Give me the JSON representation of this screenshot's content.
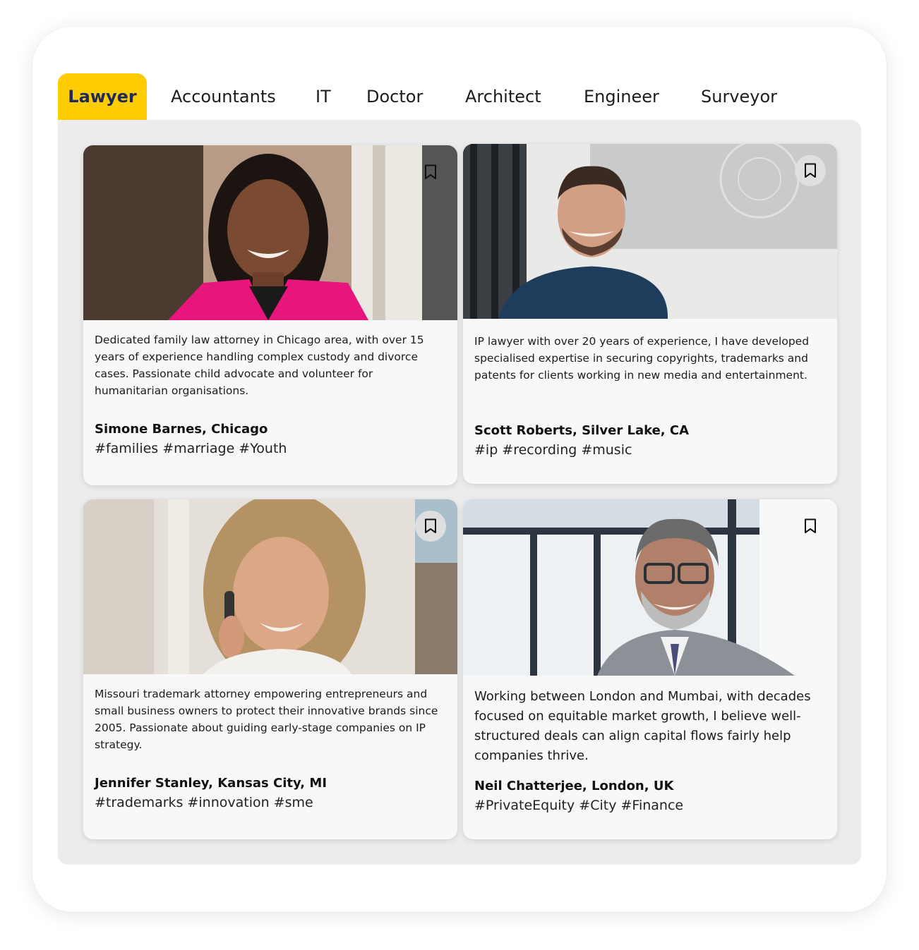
{
  "tabs": [
    {
      "label": "Lawyer",
      "active": true
    },
    {
      "label": "Accountants",
      "active": false
    },
    {
      "label": "IT",
      "active": false
    },
    {
      "label": "Doctor",
      "active": false
    },
    {
      "label": "Architect",
      "active": false
    },
    {
      "label": "Engineer",
      "active": false
    },
    {
      "label": "Surveyor",
      "active": false
    }
  ],
  "colors": {
    "accent": "#ffcc00",
    "active_tab_text": "#1f2a5c",
    "panel": "#ececec",
    "card": "#f8f8f8"
  },
  "cards": [
    {
      "description": "Dedicated family law attorney in Chicago area, with over 15 years of experience handling complex custody and divorce cases. Passionate child advocate and volunteer for humanitarian organisations.",
      "name": "Simone Barnes, Chicago",
      "tags": "#families #marriage #Youth",
      "bookmark_icon": "bookmark-icon"
    },
    {
      "description": "IP lawyer with over 20 years of experience, I have developed specialised expertise in securing copyrights, trademarks and patents for clients working in new media and entertainment.",
      "name": "Scott Roberts, Silver Lake, CA",
      "tags": "#ip #recording #music",
      "bookmark_icon": "bookmark-icon"
    },
    {
      "description": "Missouri trademark attorney empowering entrepreneurs and small business owners to protect their innovative brands since 2005. Passionate about  guiding early-stage companies on IP strategy.",
      "name": "Jennifer Stanley, Kansas City, MI",
      "tags": "#trademarks #innovation #sme",
      "bookmark_icon": "bookmark-icon"
    },
    {
      "description": "Working between London and Mumbai, with decades focused on equitable market growth, I believe well-structured deals can align capital flows  fairly help companies thrive.",
      "name": "Neil Chatterjee, London, UK",
      "tags": "#PrivateEquity #City #Finance",
      "bookmark_icon": "bookmark-icon"
    }
  ]
}
